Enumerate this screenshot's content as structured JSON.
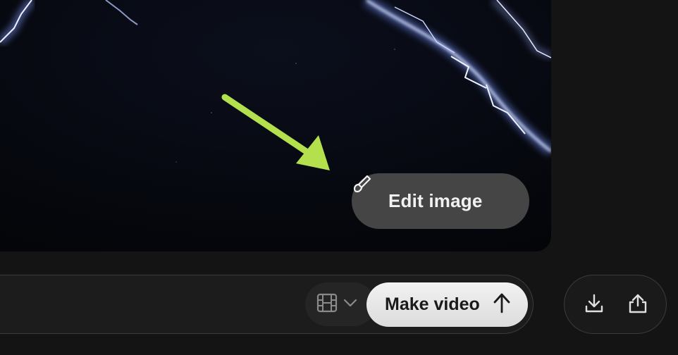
{
  "image": {
    "alt": "",
    "edit_button_label": "Edit image",
    "edit_icon": "brush-icon"
  },
  "annotation": {
    "arrow_color": "#b5e04e",
    "arrow_icon": "arrow-annotation"
  },
  "composer": {
    "mode_icon": "film-icon",
    "mode_chevron_icon": "chevron-down-icon",
    "submit_label": "Make video",
    "submit_icon": "arrow-up-icon"
  },
  "actions": {
    "download_icon": "download-icon",
    "share_icon": "share-icon"
  },
  "colors": {
    "background": "#141414",
    "edit_button_bg": "#484848",
    "submit_bg": "#e8e8e8",
    "accent_arrow": "#b5e04e"
  }
}
